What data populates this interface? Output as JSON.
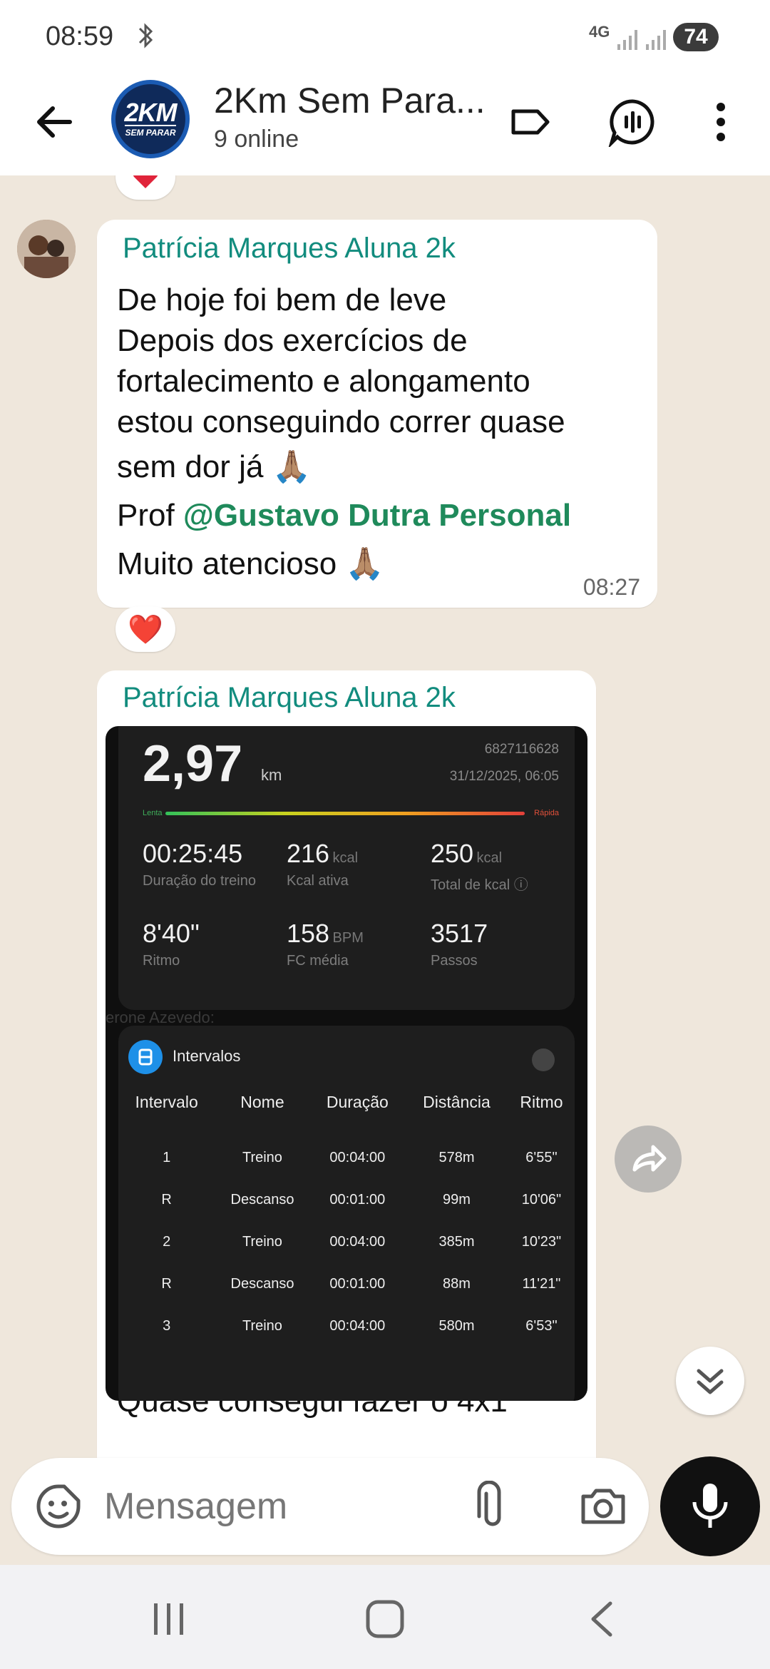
{
  "status_bar": {
    "time": "08:59",
    "network": "4G",
    "battery": "74"
  },
  "header": {
    "title": "2Km Sem Para...",
    "subtitle": "9 online",
    "avatar_line1": "2KM",
    "avatar_line2": "SEM PARAR"
  },
  "messages": {
    "m1": {
      "sender": "Patrícia Marques Aluna 2k",
      "line1": "De hoje foi bem de leve",
      "line2": "Depois dos exercícios de",
      "line3": "fortalecimento e alongamento",
      "line4": "estou conseguindo correr quase",
      "line5": "sem dor  já 🙏🏽",
      "line6_prefix": "Prof ",
      "line6_mention": "@Gustavo Dutra Personal",
      "line7": "Muito atencioso 🙏🏽",
      "time": "08:27",
      "reaction": "❤️"
    },
    "m2": {
      "sender": "Patrícia Marques Aluna 2k",
      "caption": "Quase consegui fazer o 4x1"
    }
  },
  "workout": {
    "distance": "2,97",
    "distance_unit": "km",
    "id": "6827116628",
    "datetime": "31/12/2025, 06:05",
    "pace_low": "Lenta",
    "pace_high": "Rápida",
    "stats": [
      {
        "value": "00:25:45",
        "unit": "",
        "label": "Duração do treino"
      },
      {
        "value": "216",
        "unit": "kcal",
        "label": "Kcal ativa"
      },
      {
        "value": "250",
        "unit": "kcal",
        "label": "Total de kcal ⓘ"
      },
      {
        "value": "8'40\"",
        "unit": "",
        "label": "Ritmo"
      },
      {
        "value": "158",
        "unit": "BPM",
        "label": "FC média"
      },
      {
        "value": "3517",
        "unit": "",
        "label": "Passos"
      }
    ],
    "background_text": "erone Azevedo:",
    "intervals_title": "Intervalos",
    "table_headers": [
      "Intervalo",
      "Nome",
      "Duração",
      "Distância",
      "Ritmo"
    ],
    "table_rows": [
      [
        "1",
        "Treino",
        "00:04:00",
        "578m",
        "6'55\""
      ],
      [
        "R",
        "Descanso",
        "00:01:00",
        "99m",
        "10'06\""
      ],
      [
        "2",
        "Treino",
        "00:04:00",
        "385m",
        "10'23\""
      ],
      [
        "R",
        "Descanso",
        "00:01:00",
        "88m",
        "11'21\""
      ],
      [
        "3",
        "Treino",
        "00:04:00",
        "580m",
        "6'53\""
      ]
    ]
  },
  "input": {
    "placeholder": "Mensagem"
  },
  "colors": {
    "accent": "#128c7e",
    "mention": "#1f8a5b",
    "chat_bg": "#efe7dc"
  }
}
